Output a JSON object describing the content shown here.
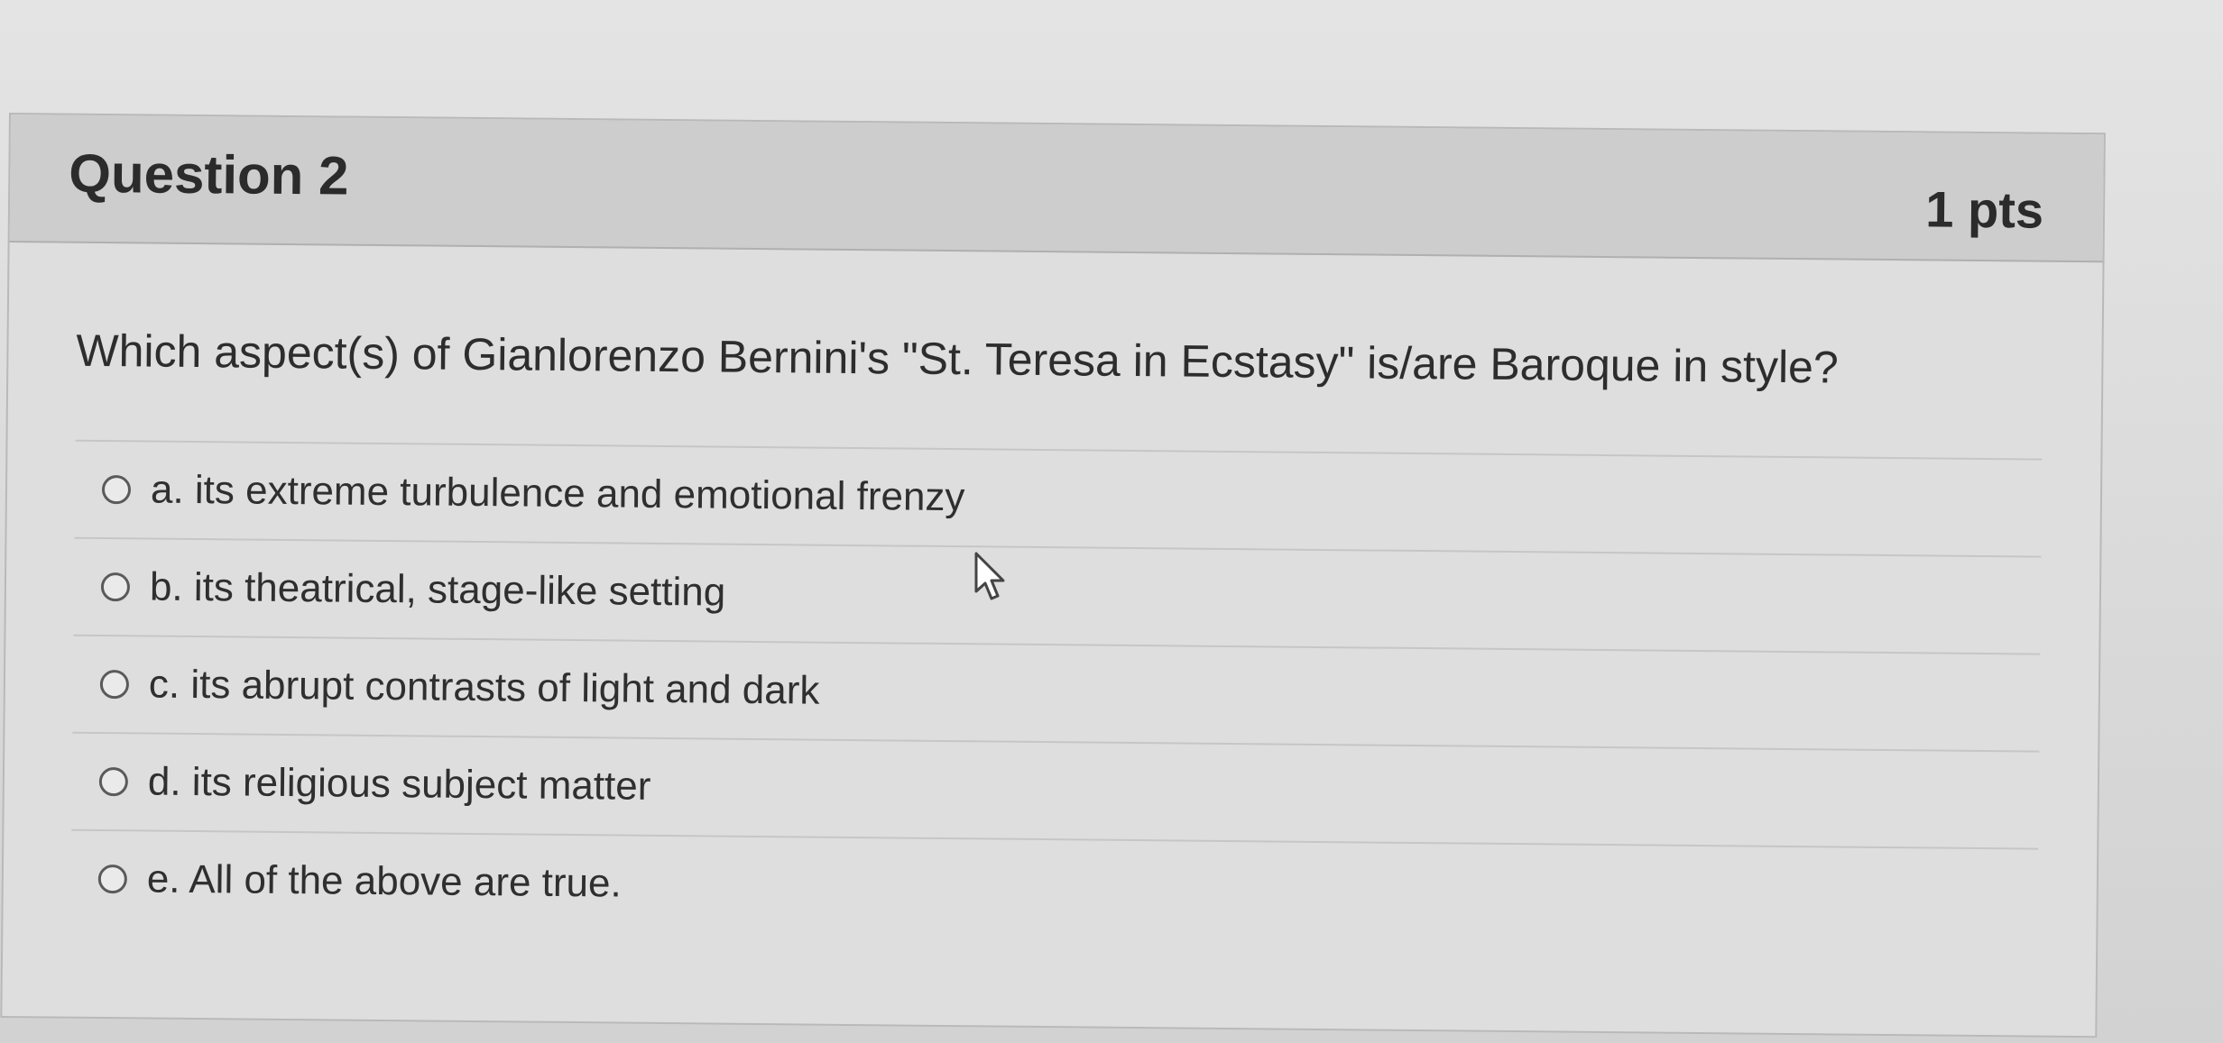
{
  "question": {
    "title": "Question 2",
    "points": "1 pts",
    "text": "Which aspect(s) of Gianlorenzo Bernini's \"St. Teresa in Ecstasy\" is/are Baroque in style?"
  },
  "answers": [
    {
      "label": "a. its extreme turbulence and emotional frenzy"
    },
    {
      "label": "b. its theatrical, stage-like setting"
    },
    {
      "label": "c. its abrupt contrasts of light and dark"
    },
    {
      "label": "d. its religious subject matter"
    },
    {
      "label": "e. All of the above are true."
    }
  ],
  "icons": {
    "radio": "radio-unselected-icon",
    "cursor": "mouse-pointer-icon"
  }
}
